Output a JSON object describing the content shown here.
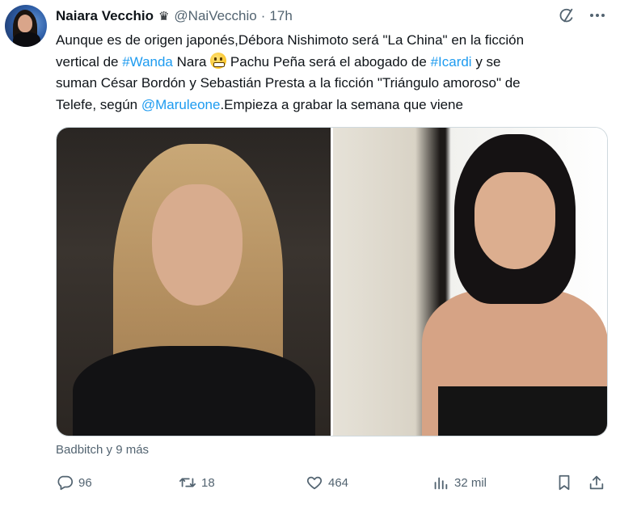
{
  "author": {
    "name": "Naiara Vecchio",
    "badge": "♛",
    "handle": "@NaiVecchio",
    "separator": "·",
    "time": "17h"
  },
  "tweet": {
    "line1": "Aunque es de origen japonés,Débora Nishimoto será \"La China\" en la ficción",
    "line2_a": "vertical de ",
    "line2_link1": "#Wanda",
    "line2_b": " Nara ",
    "line2_c": " Pachu Peña será el abogado de ",
    "line2_link2": "#Icardi",
    "line2_d": " y se",
    "line3": "suman César Bordón y Sebastián Presta a la ficción \"Triángulo amoroso\" de",
    "line4_a": "Telefe, según ",
    "line4_link": "@Maruleone",
    "line4_b": ".Empieza a grabar la semana que viene"
  },
  "icons": {
    "emoji": "grimacing-face-emoji",
    "grok": "grok-icon",
    "more": "more-icon",
    "reply": "reply-icon",
    "retweet": "retweet-icon",
    "like": "like-icon",
    "views": "views-icon",
    "bookmark": "bookmark-icon",
    "share": "share-icon"
  },
  "reactors": "Badbitch y 9 más",
  "actions": {
    "reply": "96",
    "retweet": "18",
    "like": "464",
    "views": "32 mil"
  },
  "colors": {
    "text": "#0f1419",
    "muted": "#536471",
    "link": "#1d9bf0"
  }
}
